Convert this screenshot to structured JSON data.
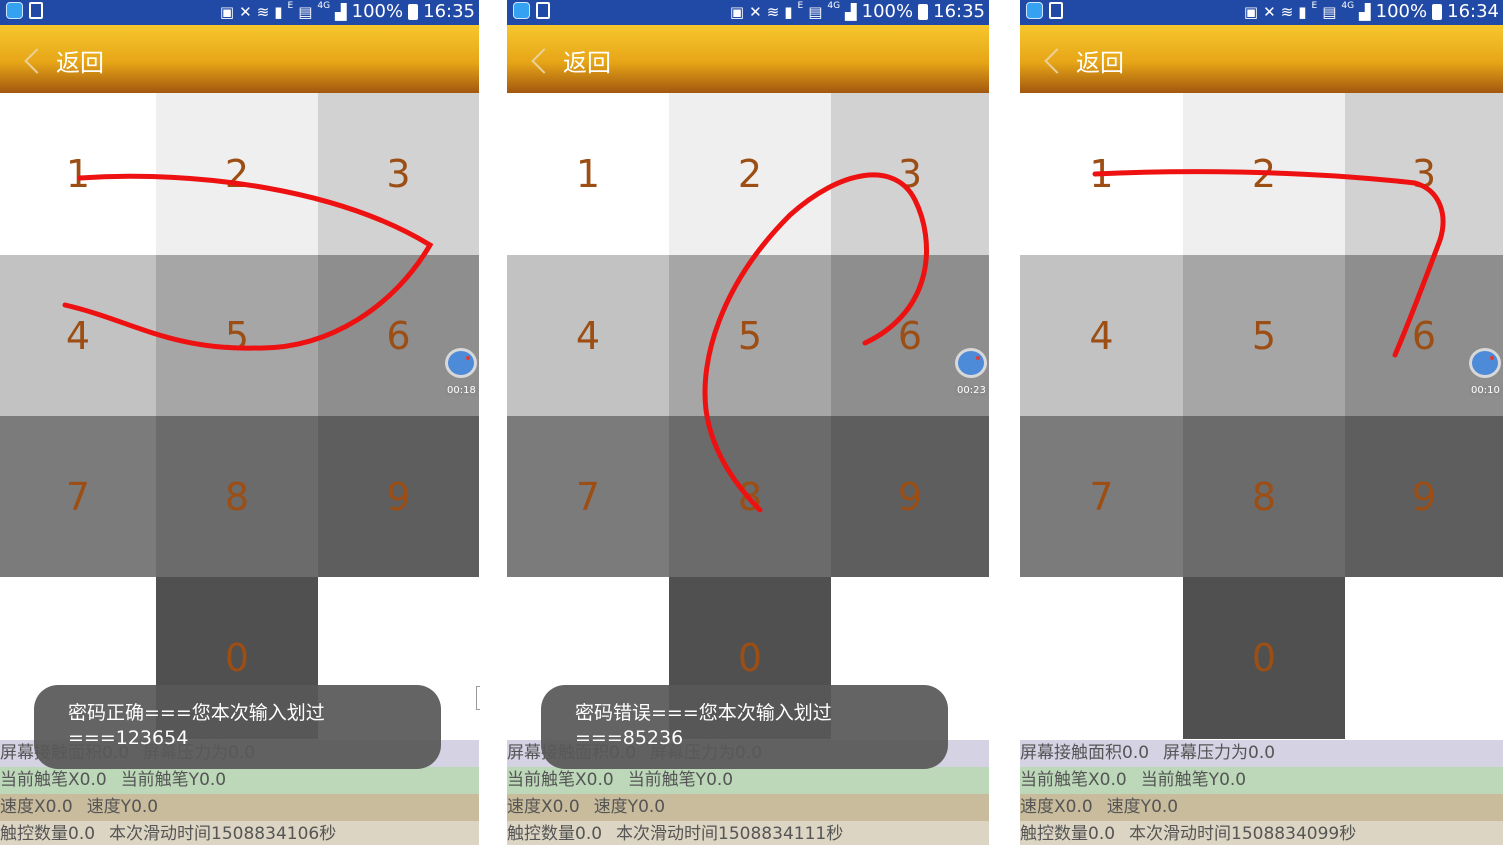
{
  "status_bar": {
    "battery": "100%",
    "network": "4G",
    "sim": "E"
  },
  "screens": [
    {
      "time": "16:35",
      "back_label": "返回",
      "keys": [
        "1",
        "2",
        "3",
        "4",
        "5",
        "6",
        "7",
        "8",
        "9",
        "",
        "0",
        ""
      ],
      "record_time": "00:18",
      "toast": {
        "line1": "密码正确===您本次输入划过",
        "line2": "===123654"
      },
      "info": {
        "area_label": "屏幕接触面积0.0",
        "pressure_label": "屏幕压力为0.0",
        "pen_x": "当前触笔X0.0",
        "pen_y": "当前触笔Y0.0",
        "speed_x": "速度X0.0",
        "speed_y": "速度Y0.0",
        "touch_count": "触控数量0.0",
        "swipe_time": "本次滑动时间1508834106秒"
      }
    },
    {
      "time": "16:35",
      "back_label": "返回",
      "keys": [
        "1",
        "2",
        "3",
        "4",
        "5",
        "6",
        "7",
        "8",
        "9",
        "",
        "0",
        ""
      ],
      "record_time": "00:23",
      "toast": {
        "line1": "密码错误===您本次输入划过",
        "line2": "===85236"
      },
      "info": {
        "area_label": "屏幕接触面积0.0",
        "pressure_label": "屏幕压力为0.0",
        "pen_x": "当前触笔X0.0",
        "pen_y": "当前触笔Y0.0",
        "speed_x": "速度X0.0",
        "speed_y": "速度Y0.0",
        "touch_count": "触控数量0.0",
        "swipe_time": "本次滑动时间1508834111秒"
      }
    },
    {
      "time": "16:34",
      "back_label": "返回",
      "keys": [
        "1",
        "2",
        "3",
        "4",
        "5",
        "6",
        "7",
        "8",
        "9",
        "",
        "0",
        ""
      ],
      "record_time": "00:10",
      "toast": null,
      "info": {
        "area_label": "屏幕接触面积0.0",
        "pressure_label": "屏幕压力为0.0",
        "pen_x": "当前触笔X0.0",
        "pen_y": "当前触笔Y0.0",
        "speed_x": "速度X0.0",
        "speed_y": "速度Y0.0",
        "touch_count": "触控数量0.0",
        "swipe_time": "本次滑动时间1508834099秒"
      }
    }
  ],
  "colors": {
    "status_bar": "#2149a6",
    "header_top": "#f7c72e",
    "header_bottom": "#a2570f",
    "digit": "#9c4e14",
    "trace": "#ee1111",
    "key_row1": [
      "#ffffff",
      "#efefef",
      "#d2d2d2"
    ],
    "key_row2": [
      "#c2c2c2",
      "#a6a6a6",
      "#8e8e8e"
    ],
    "key_row3": [
      "#7b7b7b",
      "#6b6b6b",
      "#5e5e5e"
    ],
    "key_row4": [
      "#ffffff",
      "#505050",
      "#ffffff"
    ],
    "info_rows": [
      "#d5d2e3",
      "#bcd8b9",
      "#c9bc9d",
      "#dcd5c3"
    ]
  },
  "icons": [
    "cast-icon",
    "mute-icon",
    "wifi-icon",
    "sim-icon",
    "signal-icon",
    "battery-icon",
    "record-icon",
    "back-chevron-icon"
  ]
}
